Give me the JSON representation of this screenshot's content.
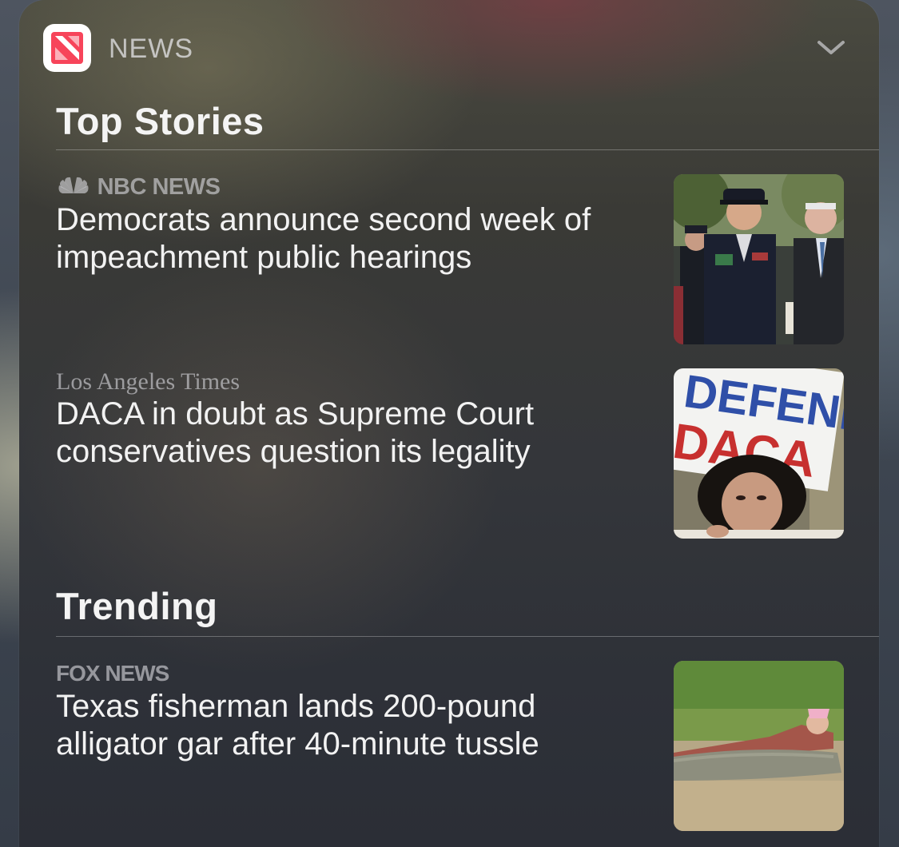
{
  "widget": {
    "app_name": "NEWS",
    "app_icon": "apple-news-icon",
    "expand_icon": "chevron-down-icon"
  },
  "sections": [
    {
      "title": "Top Stories",
      "stories": [
        {
          "source": "NBC NEWS",
          "headline": "Democrats announce second week of impeachment public hearings",
          "thumbnail": "officers-walking-photo"
        },
        {
          "source": "Los Angeles Times",
          "headline": "DACA in doubt as Supreme Court conservatives question its legality",
          "thumbnail": "defend-daca-protest-photo",
          "thumbnail_sign_line1": "DEFEND",
          "thumbnail_sign_line2": "DACA"
        }
      ]
    },
    {
      "title": "Trending",
      "stories": [
        {
          "source": "FOX NEWS",
          "headline": "Texas fisherman lands 200-pound alligator gar after 40-minute tussle",
          "thumbnail": "fisherman-alligator-gar-photo"
        }
      ]
    }
  ],
  "colors": {
    "news_icon_red": "#f7445a",
    "text_primary": "#f2f2f2"
  }
}
